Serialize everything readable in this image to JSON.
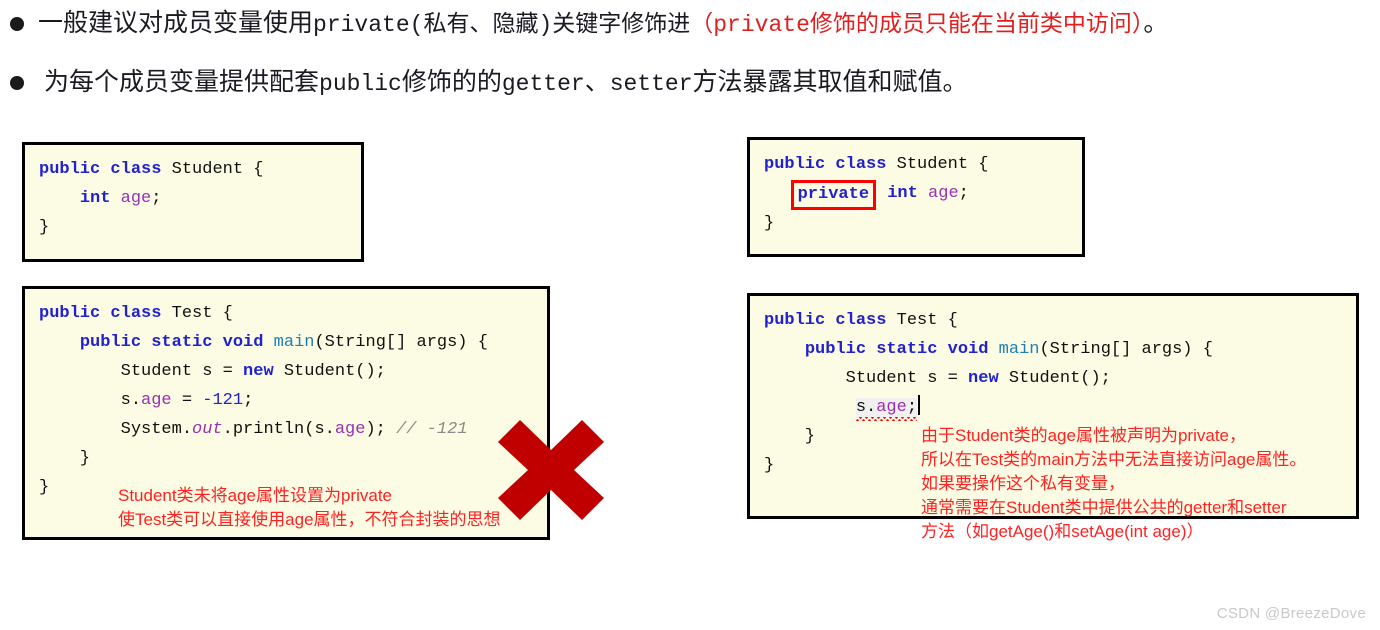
{
  "slide": {
    "bullets": [
      {
        "black_before": "一般建议对成员变量使用",
        "mono_keyword": "private",
        "black_mid": "(私有、隐藏)关键字修饰进",
        "red_note": "（private修饰的成员只能在当前类中访问）",
        "black_after": "。"
      },
      {
        "black_before": "为每个成员变量提供配套",
        "mono_keyword": "public",
        "black_mid": "修饰的的",
        "mono_keyword2": "getter",
        "black_sep": "、",
        "mono_keyword3": "setter",
        "black_after": "方法暴露其取值和赋值。"
      }
    ]
  },
  "code_boxes": {
    "student_plain": {
      "lines": [
        {
          "tokens": [
            {
              "t": "public",
              "c": "kw"
            },
            {
              "t": " ",
              "c": "typ"
            },
            {
              "t": "class",
              "c": "kw"
            },
            {
              "t": " Student {",
              "c": "typ"
            }
          ]
        },
        {
          "tokens": [
            {
              "t": "    ",
              "c": "typ"
            },
            {
              "t": "int",
              "c": "kw"
            },
            {
              "t": " ",
              "c": "typ"
            },
            {
              "t": "age",
              "c": "fld"
            },
            {
              "t": ";",
              "c": "typ"
            }
          ]
        },
        {
          "tokens": [
            {
              "t": "}",
              "c": "typ"
            }
          ]
        }
      ],
      "plain_text": "public class Student {\n    int age;\n}"
    },
    "student_private": {
      "highlighted_keyword": "private",
      "plain_text": "public class Student {\n    private int age;\n}"
    },
    "test_plain": {
      "plain_text": "public class Test {\n    public static void main(String[] args) {\n        Student s = new Student();\n        s.age = -121;\n        System.out.println(s.age); // -121\n    }\n}",
      "comment": "// -121",
      "assigned_value": "-121"
    },
    "test_private": {
      "plain_text": "public class Test {\n    public static void main(String[] args) {\n        Student s = new Student();\n        s.age;\n    }\n}",
      "error_expression": "s.age;"
    }
  },
  "annotations": {
    "left_red": "Student类未将age属性设置为private\n使Test类可以直接使用age属性，不符合封装的思想",
    "right_red": "由于Student类的age属性被声明为private，\n所以在Test类的main方法中无法直接访问age属性。\n如果要操作这个私有变量，\n通常需要在Student类中提供公共的getter和setter\n方法（如getAge()和setAge(int age)）"
  },
  "marks": {
    "cross": "red-cross-mark"
  },
  "watermark": "CSDN @BreezeDove",
  "colors": {
    "keyword_blue": "#2222cc",
    "field_purple": "#9b30b0",
    "comment_gray": "#8a8a8a",
    "annotation_red": "#ff2222",
    "highlight_red": "#ff0000",
    "cross_red": "#c00000",
    "code_bg": "#fcfce4",
    "code_border": "#000000"
  }
}
